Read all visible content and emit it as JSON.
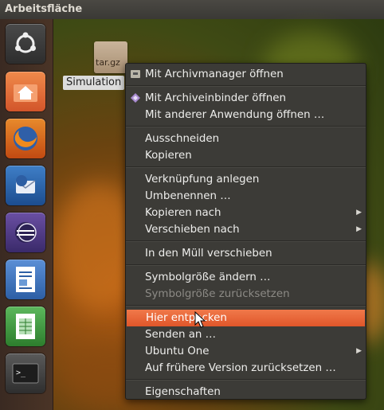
{
  "topbar": {
    "title": "Arbeitsfläche"
  },
  "launcher": {
    "items": [
      {
        "name": "ubuntu-dash-icon"
      },
      {
        "name": "home-folder-icon"
      },
      {
        "name": "firefox-icon"
      },
      {
        "name": "thunderbird-icon"
      },
      {
        "name": "eclipse-icon"
      },
      {
        "name": "writer-icon"
      },
      {
        "name": "calc-icon"
      },
      {
        "name": "terminal-icon"
      }
    ]
  },
  "desktop_file": {
    "icon_text": "tar.gz",
    "label": "Simulation"
  },
  "menu": {
    "items": [
      {
        "label": "Mit Archivmanager öffnen",
        "icon": "archive-manager-icon"
      },
      {
        "sep": true
      },
      {
        "label": "Mit Archiveinbinder öffnen",
        "icon": "archive-mounter-icon"
      },
      {
        "label": "Mit anderer Anwendung öffnen …"
      },
      {
        "sep": true
      },
      {
        "label": "Ausschneiden"
      },
      {
        "label": "Kopieren"
      },
      {
        "sep": true
      },
      {
        "label": "Verknüpfung anlegen"
      },
      {
        "label": "Umbenennen …"
      },
      {
        "label": "Kopieren nach",
        "submenu": true
      },
      {
        "label": "Verschieben nach",
        "submenu": true
      },
      {
        "sep": true
      },
      {
        "label": "In den Müll verschieben"
      },
      {
        "sep": true
      },
      {
        "label": "Symbolgröße ändern …"
      },
      {
        "label": "Symbolgröße zurücksetzen",
        "disabled": true
      },
      {
        "sep": true
      },
      {
        "label": "Hier entpacken",
        "highlighted": true
      },
      {
        "label": "Senden an …"
      },
      {
        "label": "Ubuntu One",
        "submenu": true
      },
      {
        "label": "Auf frühere Version zurücksetzen …"
      },
      {
        "sep": true
      },
      {
        "label": "Eigenschaften"
      }
    ]
  }
}
